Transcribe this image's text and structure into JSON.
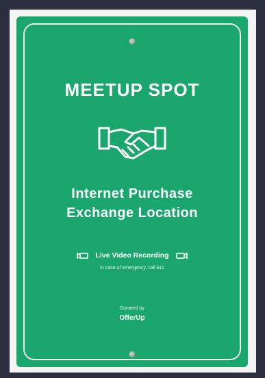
{
  "sign": {
    "title": "MEETUP SPOT",
    "subtitle_line1": "Internet Purchase",
    "subtitle_line2": "Exchange Location",
    "recording_label": "Live Video Recording",
    "emergency_note": "In case of emergency, call 911",
    "donated_by": "Donated by",
    "brand": "OfferUp",
    "colors": {
      "background": "#1aa66c",
      "text": "#ffffff",
      "border": "#e9f7ef"
    },
    "icons": [
      "handshake-icon",
      "camera-icon",
      "bolt-icon"
    ]
  }
}
